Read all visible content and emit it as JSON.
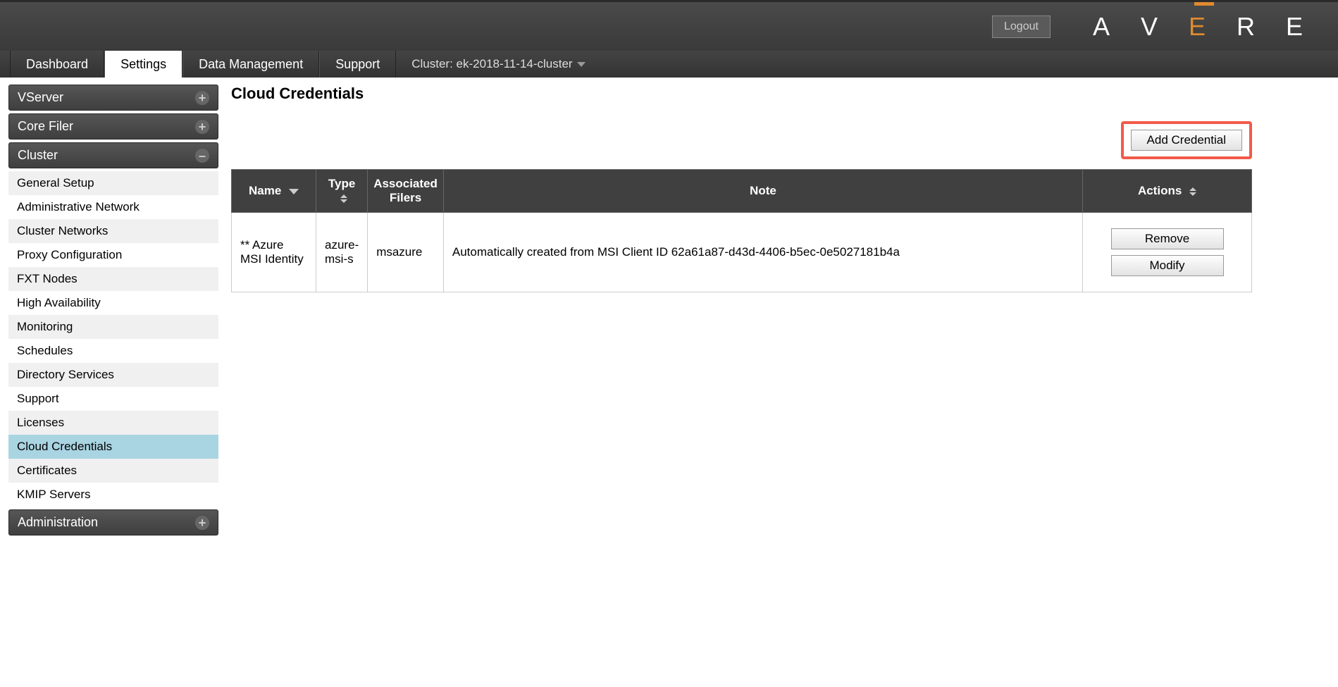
{
  "topbar": {
    "logout": "Logout",
    "logo_letters": [
      "A",
      "V",
      "E",
      "R",
      "E"
    ]
  },
  "navbar": {
    "tabs": [
      {
        "label": "Dashboard"
      },
      {
        "label": "Settings",
        "active": true
      },
      {
        "label": "Data Management"
      },
      {
        "label": "Support"
      }
    ],
    "cluster_label": "Cluster: ek-2018-11-14-cluster"
  },
  "sidebar": {
    "sections": [
      {
        "title": "VServer",
        "expanded": false,
        "items": []
      },
      {
        "title": "Core Filer",
        "expanded": false,
        "items": []
      },
      {
        "title": "Cluster",
        "expanded": true,
        "items": [
          "General Setup",
          "Administrative Network",
          "Cluster Networks",
          "Proxy Configuration",
          "FXT Nodes",
          "High Availability",
          "Monitoring",
          "Schedules",
          "Directory Services",
          "Support",
          "Licenses",
          "Cloud Credentials",
          "Certificates",
          "KMIP Servers"
        ],
        "active_item": "Cloud Credentials"
      },
      {
        "title": "Administration",
        "expanded": false,
        "items": []
      }
    ]
  },
  "page": {
    "title": "Cloud Credentials",
    "add_button": "Add Credential",
    "table": {
      "headers": {
        "name": "Name",
        "type": "Type",
        "assoc": "Associated Filers",
        "note": "Note",
        "actions": "Actions"
      },
      "rows": [
        {
          "name": "** Azure MSI Identity",
          "type": "azure-msi-s",
          "assoc": "msazure",
          "note": "Automatically created from MSI Client ID 62a61a87-d43d-4406-b5ec-0e5027181b4a",
          "actions": {
            "remove": "Remove",
            "modify": "Modify"
          }
        }
      ]
    }
  }
}
